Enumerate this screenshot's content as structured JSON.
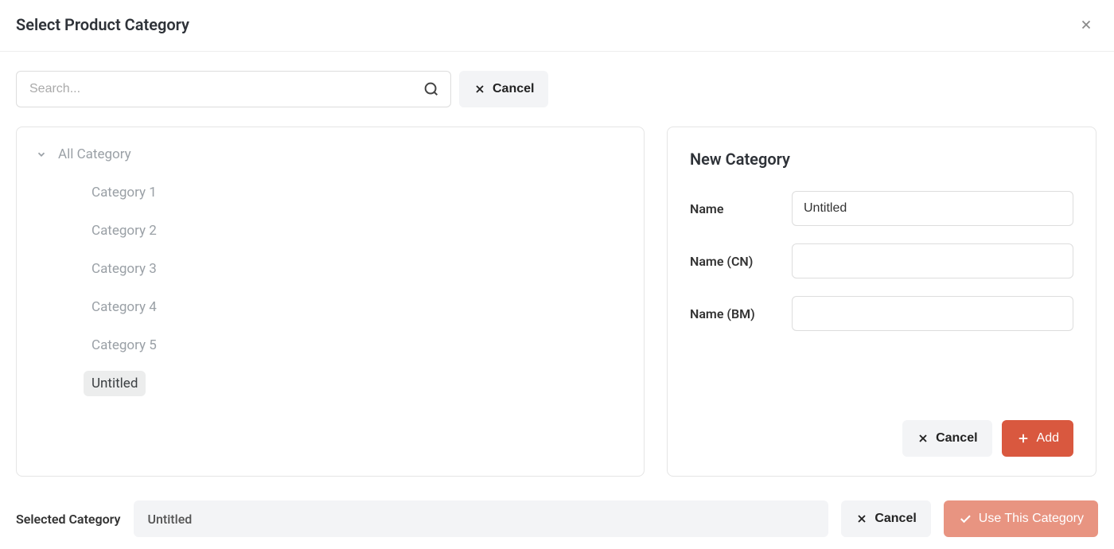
{
  "header": {
    "title": "Select Product Category"
  },
  "search": {
    "placeholder": "Search...",
    "cancel_label": "Cancel"
  },
  "tree": {
    "root_label": "All Category",
    "items": [
      {
        "label": "Category 1",
        "selected": false
      },
      {
        "label": "Category 2",
        "selected": false
      },
      {
        "label": "Category 3",
        "selected": false
      },
      {
        "label": "Category 4",
        "selected": false
      },
      {
        "label": "Category 5",
        "selected": false
      },
      {
        "label": "Untitled",
        "selected": true
      }
    ]
  },
  "new_category": {
    "title": "New Category",
    "name_label": "Name",
    "name_value": "Untitled",
    "name_cn_label": "Name (CN)",
    "name_cn_value": "",
    "name_bm_label": "Name (BM)",
    "name_bm_value": "",
    "cancel_label": "Cancel",
    "add_label": "Add"
  },
  "footer": {
    "selected_label": "Selected Category",
    "selected_value": "Untitled",
    "cancel_label": "Cancel",
    "use_label": "Use This Category"
  }
}
